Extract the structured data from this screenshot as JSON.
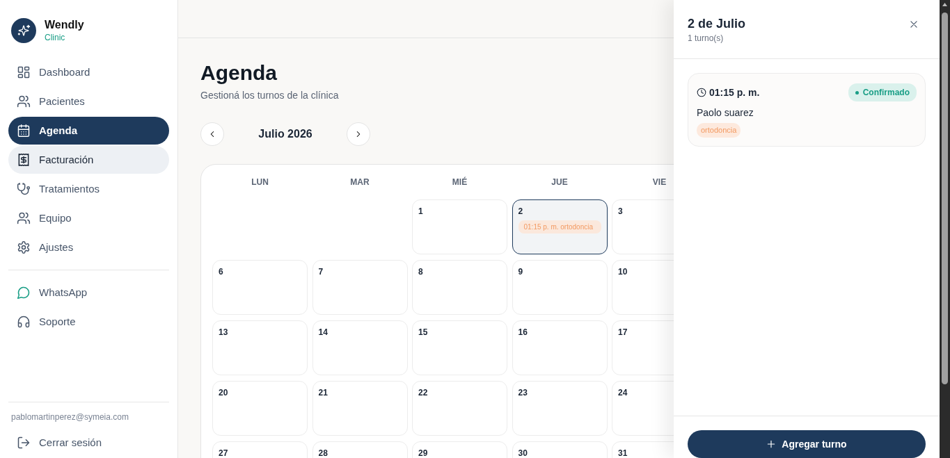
{
  "brand": {
    "name": "Wendly",
    "subtitle": "Clinic"
  },
  "nav": [
    {
      "label": "Dashboard",
      "selected": false,
      "hovered": false
    },
    {
      "label": "Pacientes",
      "selected": false,
      "hovered": false
    },
    {
      "label": "Agenda",
      "selected": true,
      "hovered": false
    },
    {
      "label": "Facturación",
      "selected": false,
      "hovered": true
    },
    {
      "label": "Tratamientos",
      "selected": false,
      "hovered": false
    },
    {
      "label": "Equipo",
      "selected": false,
      "hovered": false
    },
    {
      "label": "Ajustes",
      "selected": false,
      "hovered": false
    }
  ],
  "secondary_nav": [
    {
      "label": "WhatsApp"
    },
    {
      "label": "Soporte"
    }
  ],
  "user": {
    "email": "pablomartinperez@symeia.com"
  },
  "logout": {
    "label": "Cerrar sesión"
  },
  "page": {
    "title": "Agenda",
    "subtitle": "Gestioná los turnos de la clínica"
  },
  "calendar": {
    "month_label": "Julio 2026",
    "weekdays": [
      "LUN",
      "MAR",
      "MIÉ",
      "JUE",
      "VIE"
    ],
    "weeks": [
      [
        {
          "kind": "blank"
        },
        {
          "kind": "blank"
        },
        {
          "kind": "day",
          "day": "1",
          "selected": false
        },
        {
          "kind": "day",
          "day": "2",
          "selected": true,
          "events": [
            {
              "label": "01:15 p. m. ortodoncia"
            }
          ]
        },
        {
          "kind": "day",
          "day": "3",
          "selected": false
        }
      ],
      [
        {
          "kind": "day",
          "day": "6",
          "selected": false
        },
        {
          "kind": "day",
          "day": "7",
          "selected": false
        },
        {
          "kind": "day",
          "day": "8",
          "selected": false
        },
        {
          "kind": "day",
          "day": "9",
          "selected": false
        },
        {
          "kind": "day",
          "day": "10",
          "selected": false
        }
      ],
      [
        {
          "kind": "day",
          "day": "13",
          "selected": false
        },
        {
          "kind": "day",
          "day": "14",
          "selected": false
        },
        {
          "kind": "day",
          "day": "15",
          "selected": false
        },
        {
          "kind": "day",
          "day": "16",
          "selected": false
        },
        {
          "kind": "day",
          "day": "17",
          "selected": false
        }
      ],
      [
        {
          "kind": "day",
          "day": "20",
          "selected": false
        },
        {
          "kind": "day",
          "day": "21",
          "selected": false
        },
        {
          "kind": "day",
          "day": "22",
          "selected": false
        },
        {
          "kind": "day",
          "day": "23",
          "selected": false
        },
        {
          "kind": "day",
          "day": "24",
          "selected": false
        }
      ],
      [
        {
          "kind": "day",
          "day": "27",
          "selected": false
        },
        {
          "kind": "day",
          "day": "28",
          "selected": false
        },
        {
          "kind": "day",
          "day": "29",
          "selected": false
        },
        {
          "kind": "day",
          "day": "30",
          "selected": false
        },
        {
          "kind": "day",
          "day": "31",
          "selected": false
        }
      ]
    ]
  },
  "panel": {
    "title": "2 de Julio",
    "count": "1 turno(s)",
    "appointments": [
      {
        "time": "01:15 p. m.",
        "status": "Confirmado",
        "patient": "Paolo suarez",
        "tag": "ortodoncia"
      }
    ],
    "add_button": "Agregar turno"
  }
}
